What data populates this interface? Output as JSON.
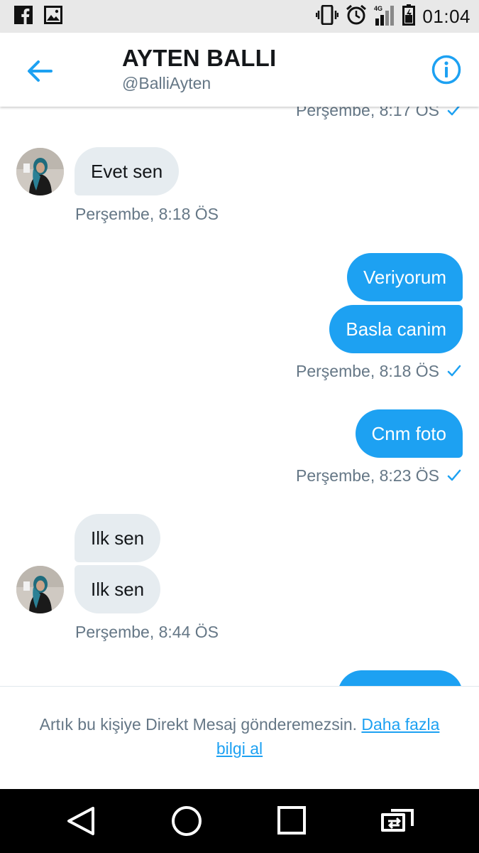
{
  "status_bar": {
    "time": "01:04",
    "network": "4G",
    "icons": [
      "facebook-icon",
      "gallery-icon",
      "vibrate-icon",
      "alarm-icon",
      "signal-icon",
      "battery-icon"
    ]
  },
  "header": {
    "title": "AYTEN BALLI",
    "handle": "@BalliAyten",
    "back_icon": "arrow-left-icon",
    "info_icon": "info-icon"
  },
  "conversation": {
    "clipped_timestamp": "Perşembe, 8:17 ÖS",
    "messages": [
      {
        "direction": "in",
        "text": "Evet sen"
      },
      {
        "direction": "in",
        "timestamp": "Perşembe, 8:18 ÖS"
      },
      {
        "direction": "out",
        "text": "Veriyorum"
      },
      {
        "direction": "out",
        "text": "Basla canim"
      },
      {
        "direction": "out",
        "timestamp": "Perşembe, 8:18 ÖS"
      },
      {
        "direction": "out",
        "text": "Cnm foto"
      },
      {
        "direction": "out",
        "timestamp": "Perşembe, 8:23 ÖS"
      },
      {
        "direction": "in",
        "text": "Ilk sen"
      },
      {
        "direction": "in",
        "text": "Ilk sen"
      },
      {
        "direction": "in",
        "timestamp": "Perşembe, 8:44 ÖS"
      }
    ]
  },
  "footer": {
    "notice": "Artık bu kişiye Direkt Mesaj gönderemezsin.",
    "link": "Daha fazla bilgi al"
  },
  "navbar": {
    "icons": [
      "back-triangle-icon",
      "home-circle-icon",
      "recents-square-icon",
      "switch-app-icon"
    ]
  },
  "colors": {
    "accent": "#1da1f2",
    "incoming_bubble": "#e6ecf0",
    "secondary_text": "#657786",
    "primary_text": "#14171a"
  }
}
